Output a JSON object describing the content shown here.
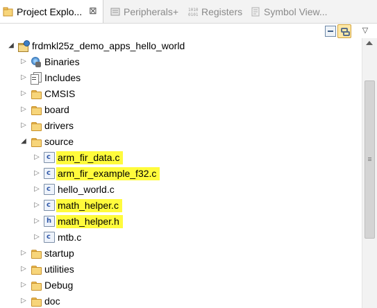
{
  "tabs": [
    {
      "label": "Project Explo...",
      "icon": "project-explorer-icon",
      "close": "⊠",
      "active": true
    },
    {
      "label": "Peripherals+",
      "icon": "peripherals-icon",
      "active": false
    },
    {
      "label": "Registers",
      "icon": "registers-icon",
      "active": false
    },
    {
      "label": "Symbol View...",
      "icon": "symbol-viewer-icon",
      "active": false
    }
  ],
  "toolbar": {
    "collapse_icon": "collapse-all-icon",
    "link_icon": "link-with-editor-icon",
    "menu_icon": "view-menu-icon",
    "menu_glyph": "▽"
  },
  "tree": {
    "project": {
      "label": "frdmkl25z_demo_apps_hello_world",
      "expanded": true
    },
    "items": [
      {
        "label": "Binaries",
        "icon": "binaries-icon",
        "expanded": false
      },
      {
        "label": "Includes",
        "icon": "includes-icon",
        "expanded": false
      },
      {
        "label": "CMSIS",
        "icon": "folder-icon",
        "expanded": false
      },
      {
        "label": "board",
        "icon": "folder-icon",
        "expanded": false
      },
      {
        "label": "drivers",
        "icon": "folder-icon",
        "expanded": false
      },
      {
        "label": "source",
        "icon": "folder-icon",
        "expanded": true,
        "children": [
          {
            "label": "arm_fir_data.c",
            "letter": "c",
            "highlight": true
          },
          {
            "label": "arm_fir_example_f32.c",
            "letter": "c",
            "highlight": true
          },
          {
            "label": "hello_world.c",
            "letter": "c",
            "highlight": false
          },
          {
            "label": "math_helper.c",
            "letter": "c",
            "highlight": true
          },
          {
            "label": "math_helper.h",
            "letter": "h",
            "highlight": true
          },
          {
            "label": "mtb.c",
            "letter": "c",
            "highlight": false
          }
        ]
      },
      {
        "label": "startup",
        "icon": "folder-icon",
        "expanded": false
      },
      {
        "label": "utilities",
        "icon": "folder-icon",
        "expanded": false
      },
      {
        "label": "Debug",
        "icon": "folder-icon",
        "expanded": false
      },
      {
        "label": "doc",
        "icon": "folder-icon",
        "expanded": false
      }
    ]
  },
  "colors": {
    "highlight": "#fffb3c",
    "folder": "#f7d57a",
    "tab_active_bg": "#ffffff",
    "tab_bar_bg": "#f3f3f3"
  }
}
